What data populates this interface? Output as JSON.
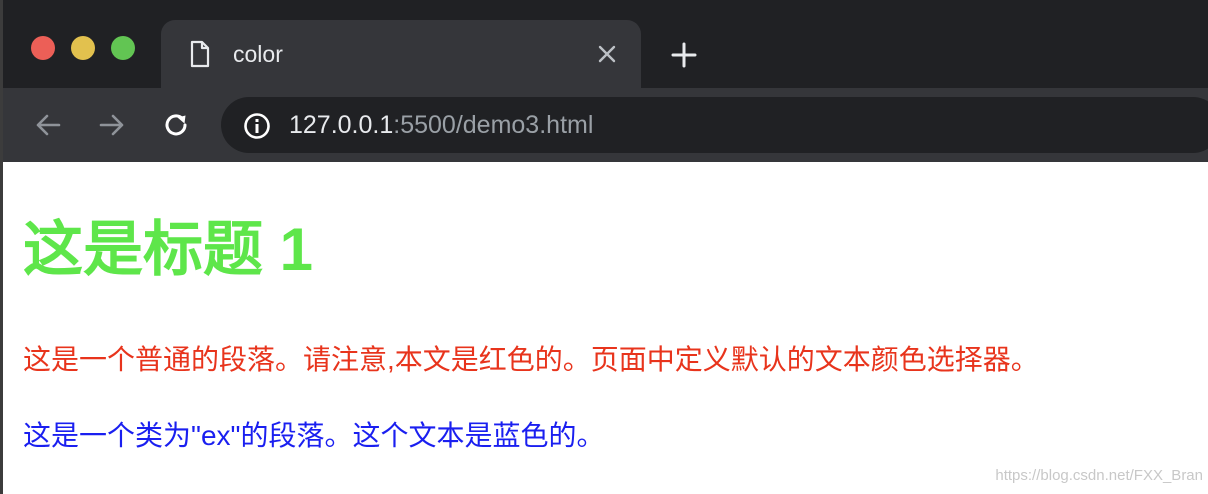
{
  "colors": {
    "heading": "#5ee64a",
    "paragraph_default": "#e8341c",
    "paragraph_ex": "#1a1ff0"
  },
  "browser": {
    "tab": {
      "title": "color",
      "icon": "document-icon",
      "close_icon": "close-icon"
    },
    "new_tab_icon": "plus-icon",
    "nav": {
      "back_icon": "arrow-left-icon",
      "forward_icon": "arrow-right-icon",
      "reload_icon": "reload-icon"
    },
    "address": {
      "info_icon": "info-icon",
      "host": "127.0.0.1",
      "rest": ":5500/demo3.html"
    }
  },
  "page": {
    "heading": "这是标题 1",
    "paragraph_default": "这是一个普通的段落。请注意,本文是红色的。页面中定义默认的文本颜色选择器。",
    "paragraph_ex": "这是一个类为\"ex\"的段落。这个文本是蓝色的。"
  },
  "watermark": "https://blog.csdn.net/FXX_Bran"
}
